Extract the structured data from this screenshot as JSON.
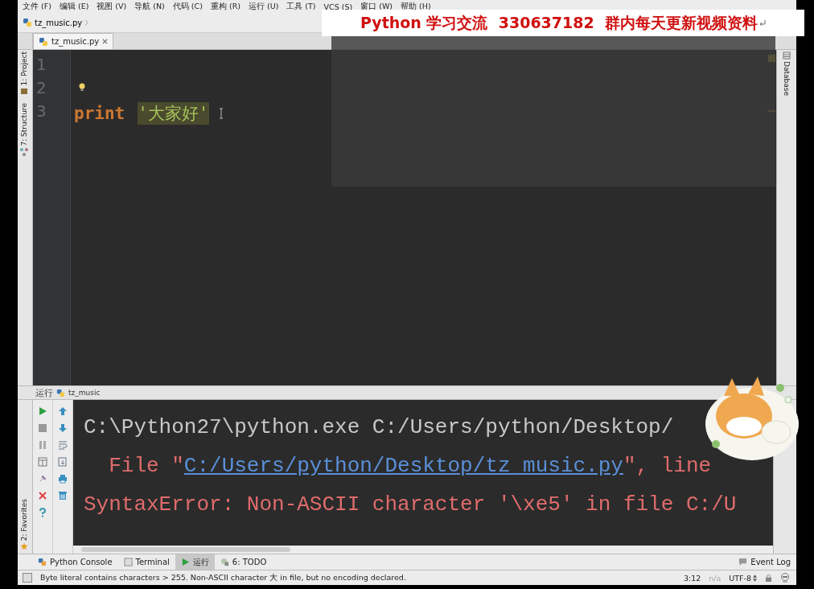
{
  "menu": [
    {
      "label": "文件 (F)"
    },
    {
      "label": "编辑 (E)"
    },
    {
      "label": "视图 (V)"
    },
    {
      "label": "导航 (N)"
    },
    {
      "label": "代码 (C)"
    },
    {
      "label": "重构 (R)"
    },
    {
      "label": "运行 (U)"
    },
    {
      "label": "工具 (T)"
    },
    {
      "label": "VCS (S)"
    },
    {
      "label": "窗口 (W)"
    },
    {
      "label": "帮助 (H)"
    }
  ],
  "breadcrumb": "tz_music.py",
  "editor_tabs": [
    {
      "label": "tz_music.py",
      "selected": true
    }
  ],
  "left_tool_windows": [
    "1: Project",
    "7: Structure"
  ],
  "right_tool_windows": [
    "Database"
  ],
  "editor": {
    "lines": [
      {
        "number": "1"
      },
      {
        "number": "2",
        "bulb": true
      },
      {
        "number": "3",
        "tokens": [
          {
            "kind": "keyword",
            "text": "print"
          },
          {
            "kind": "string",
            "text": "'大家好'"
          }
        ]
      }
    ]
  },
  "run_panel": {
    "title": "运行",
    "tab": "tz_music",
    "console": [
      {
        "segments": [
          {
            "kind": "plain",
            "text": "C:\\Python27\\python.exe C:/Users/python/Desktop/"
          }
        ]
      },
      {
        "segments": [
          {
            "kind": "error",
            "text": "  File \""
          },
          {
            "kind": "link",
            "text": "C:/Users/python/Desktop/tz_music.py"
          },
          {
            "kind": "error",
            "text": "\", line"
          }
        ]
      },
      {
        "segments": [
          {
            "kind": "error",
            "text": "SyntaxError: Non-ASCII character '\\xe5' in file C:/U"
          }
        ]
      }
    ]
  },
  "favorites": "2: Favorites",
  "bottom_tabs": [
    {
      "label": "Python Console",
      "selected": false
    },
    {
      "label": "Terminal",
      "selected": false
    },
    {
      "label": "运行",
      "selected": true
    },
    {
      "label": "6: TODO",
      "selected": false
    }
  ],
  "event_log": "Event Log",
  "status": {
    "message": "Byte literal contains characters > 255. Non-ASCII character 大 in file, but no encoding declared.",
    "position": "3:12",
    "column_2": "n/a",
    "encoding": "UTF-8"
  },
  "banner": "Python 学习交流  330637182  群内每天更新视频资料"
}
